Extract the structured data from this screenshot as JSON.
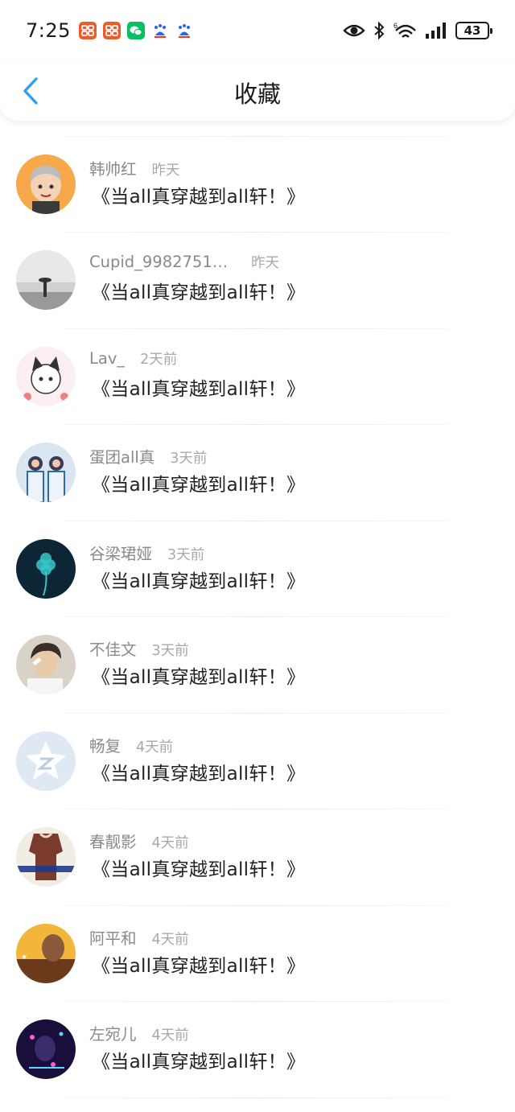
{
  "status_bar": {
    "time": "7:25",
    "battery": "43",
    "notification_icons": [
      {
        "name": "app-icon-1",
        "color": "#f05a28"
      },
      {
        "name": "app-icon-2",
        "color": "#f05a28"
      },
      {
        "name": "wechat-icon",
        "color": "#07c160"
      },
      {
        "name": "baidu-icon",
        "color": "#2a64e8"
      },
      {
        "name": "baidu-icon",
        "color": "#2a64e8"
      }
    ],
    "network_label": "6"
  },
  "header": {
    "title": "收藏",
    "accent_color": "#2ea0f0"
  },
  "items": [
    {
      "username": "",
      "time": "",
      "title": "《当all真穿越到all轩！》",
      "avatar": "black"
    },
    {
      "username": "韩帅红",
      "time": "昨天",
      "title": "《当all真穿越到all轩！》",
      "avatar": "cartoon-boy"
    },
    {
      "username": "Cupid_99827516...",
      "time": "昨天",
      "title": "《当all真穿越到all轩！》",
      "avatar": "misty"
    },
    {
      "username": "Lav_",
      "time": "2天前",
      "title": "《当all真穿越到all轩！》",
      "avatar": "kuromi"
    },
    {
      "username": "蛋团all真",
      "time": "3天前",
      "title": "《当all真穿越到all轩！》",
      "avatar": "duo"
    },
    {
      "username": "谷梁珺娅",
      "time": "3天前",
      "title": "《当all真穿越到all轩！》",
      "avatar": "clover"
    },
    {
      "username": "不佳文",
      "time": "3天前",
      "title": "《当all真穿越到all轩！》",
      "avatar": "portrait"
    },
    {
      "username": "畅复",
      "time": "4天前",
      "title": "《当all真穿越到all轩！》",
      "avatar": "default-z"
    },
    {
      "username": "春靓影",
      "time": "4天前",
      "title": "《当all真穿越到all轩！》",
      "avatar": "tshirt"
    },
    {
      "username": "阿平和",
      "time": "4天前",
      "title": "《当all真穿越到all轩！》",
      "avatar": "golden"
    },
    {
      "username": "左宛儿",
      "time": "4天前",
      "title": "《当all真穿越到all轩！》",
      "avatar": "neon"
    }
  ]
}
